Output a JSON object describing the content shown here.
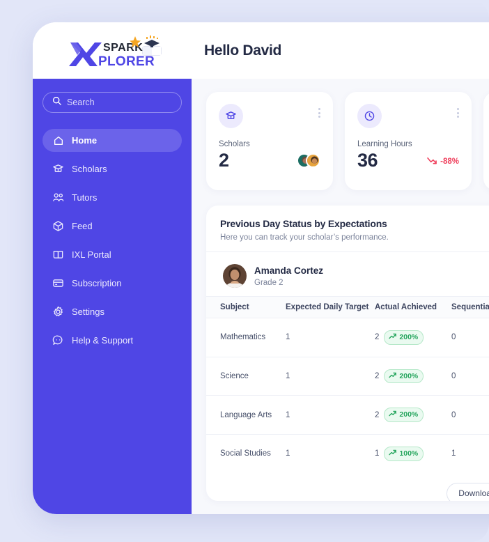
{
  "brand": {
    "logo_text_top": "SPARK",
    "logo_text_bottom": "XPLORER",
    "purple": "#4f46e5",
    "accent_orange": "#f5a623"
  },
  "header": {
    "greeting": "Hello David"
  },
  "sidebar": {
    "search": {
      "placeholder": "Search",
      "value": "",
      "icon": "search-icon"
    },
    "items": [
      {
        "label": "Home",
        "icon": "home-icon",
        "active": true
      },
      {
        "label": "Scholars",
        "icon": "graduation-cap-icon",
        "active": false
      },
      {
        "label": "Tutors",
        "icon": "users-icon",
        "active": false
      },
      {
        "label": "Feed",
        "icon": "cube-icon",
        "active": false
      },
      {
        "label": "IXL Portal",
        "icon": "book-icon",
        "active": false
      },
      {
        "label": "Subscription",
        "icon": "credit-card-icon",
        "active": false
      },
      {
        "label": "Settings",
        "icon": "gear-icon",
        "active": false
      },
      {
        "label": "Help & Support",
        "icon": "chat-help-icon",
        "active": false
      }
    ]
  },
  "stat_cards": [
    {
      "label": "Scholars",
      "value": "2",
      "icon": "graduation-cap-icon",
      "menu_icon": "dots-vertical-icon",
      "avatars": 2
    },
    {
      "label": "Learning Hours",
      "value": "36",
      "icon": "clock-icon",
      "menu_icon": "dots-vertical-icon",
      "trend": {
        "text": "-88%",
        "direction": "down",
        "color": "#ef3f5c",
        "icon": "trend-down-icon"
      }
    }
  ],
  "panel": {
    "title": "Previous Day Status by Expectations",
    "subtitle": "Here you can track your scholar’s performance.",
    "scholar": {
      "name": "Amanda Cortez",
      "grade": "Grade 2",
      "avatar": "scholar-avatar"
    },
    "table": {
      "columns": [
        "Subject",
        "Expected Daily Target",
        "Actual Achieved",
        "Sequential"
      ],
      "rows": [
        {
          "subject": "Mathematics",
          "target": "1",
          "actual": "2",
          "pill": "200%",
          "pill_icon": "trend-up-icon",
          "sequential": "0"
        },
        {
          "subject": "Science",
          "target": "1",
          "actual": "2",
          "pill": "200%",
          "pill_icon": "trend-up-icon",
          "sequential": "0"
        },
        {
          "subject": "Language Arts",
          "target": "1",
          "actual": "2",
          "pill": "200%",
          "pill_icon": "trend-up-icon",
          "sequential": "0"
        },
        {
          "subject": "Social Studies",
          "target": "1",
          "actual": "1",
          "pill": "100%",
          "pill_icon": "trend-up-icon",
          "sequential": "1"
        }
      ]
    },
    "download_label": "Download Report"
  }
}
